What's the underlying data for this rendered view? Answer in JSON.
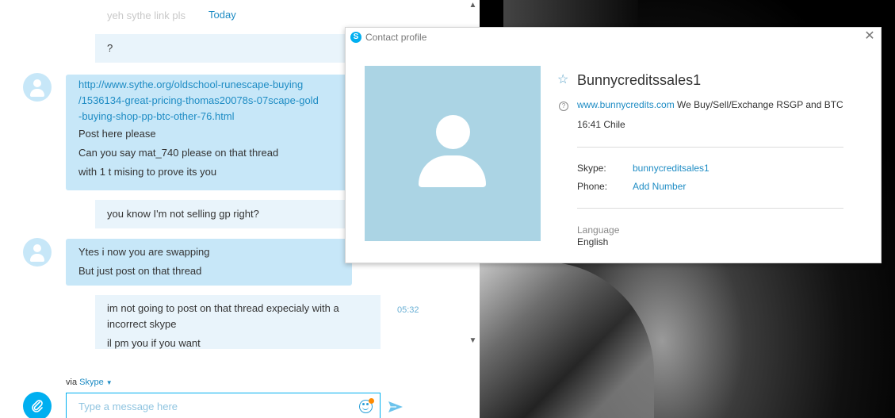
{
  "chat": {
    "top_partial": {
      "text": "yeh sythe link pls",
      "time": "Today"
    },
    "messages": [
      {
        "text": "?"
      },
      {
        "lines": [
          "http://www.sythe.org/oldschool-runescape-buying",
          "/1536134-great-pricing-thomas20078s-07scape-gold",
          "-buying-shop-pp-btc-other-76.html",
          "Post here please",
          "Can you say mat_740 please on that thread",
          "with 1 t mising to prove its you"
        ]
      },
      {
        "text": "you know I'm not selling gp right?"
      },
      {
        "lines": [
          "Ytes i now you are swapping",
          "But just post on that thread"
        ]
      },
      {
        "lines": [
          "im not going to post on that thread expecialy with a",
          "incorrect skype",
          "il pm you if you want"
        ],
        "time": "05:32"
      }
    ]
  },
  "compose": {
    "via_prefix": "via",
    "via_service": "Skype",
    "placeholder": "Type a message here"
  },
  "profile": {
    "title": "Contact profile",
    "name": "Bunnycreditssales1",
    "mood_link": "www.bunnycredits.com",
    "mood_text": " We Buy/Sell/Exchange RSGP and BTC",
    "local_time": "16:41 Chile",
    "skype_label": "Skype:",
    "skype_value": "bunnycreditsales1",
    "phone_label": "Phone:",
    "phone_value": "Add Number",
    "language_label": "Language",
    "language_value": "English"
  },
  "colors": {
    "accent": "#00aff0",
    "bubble_in": "#c7e7f8",
    "bubble_out": "#e9f4fb",
    "link": "#1e8cc4"
  }
}
